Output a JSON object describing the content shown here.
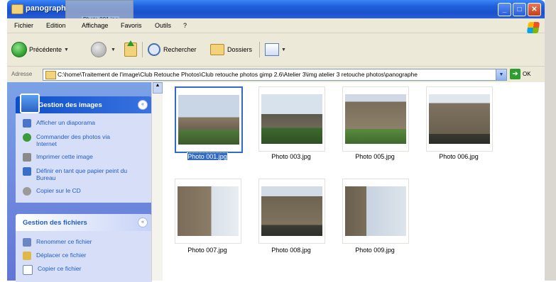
{
  "window": {
    "title": "panograph",
    "drag_label": "Photo 001.jpg"
  },
  "menu": [
    "Fichier",
    "Edition",
    "Affichage",
    "Favoris",
    "Outils",
    "?"
  ],
  "toolbar": {
    "back_label": "Précédente",
    "search_label": "Rechercher",
    "folders_label": "Dossiers"
  },
  "address": {
    "label": "Adresse",
    "path": "C:\\home\\Traitement de l'image\\Club Retouche Photos\\Club retouche photos gimp 2.6\\Atelier 3\\img atelier 3 retouche photos\\panographe",
    "go_label": "OK"
  },
  "image_tasks": {
    "title": "Gestion des images",
    "items": [
      "Afficher un diaporama",
      "Commander des photos via Internet",
      "Imprimer cette image",
      "Définir en tant que papier peint du Bureau",
      "Copier sur le CD"
    ]
  },
  "file_tasks": {
    "title": "Gestion des fichiers",
    "items": [
      "Renommer ce fichier",
      "Déplacer ce fichier",
      "Copier ce fichier"
    ]
  },
  "files": [
    {
      "name": "Photo 001.jpg",
      "selected": true
    },
    {
      "name": "Photo 003.jpg",
      "selected": false
    },
    {
      "name": "Photo 005.jpg",
      "selected": false
    },
    {
      "name": "Photo 006.jpg",
      "selected": false
    },
    {
      "name": "Photo 007.jpg",
      "selected": false
    },
    {
      "name": "Photo 008.jpg",
      "selected": false
    },
    {
      "name": "Photo 009.jpg",
      "selected": false
    }
  ],
  "colors": {
    "title_bar": "#1f5fdc",
    "selection": "#316ac5",
    "task_pane": "#7ba2e7",
    "link_text": "#215dc6"
  }
}
